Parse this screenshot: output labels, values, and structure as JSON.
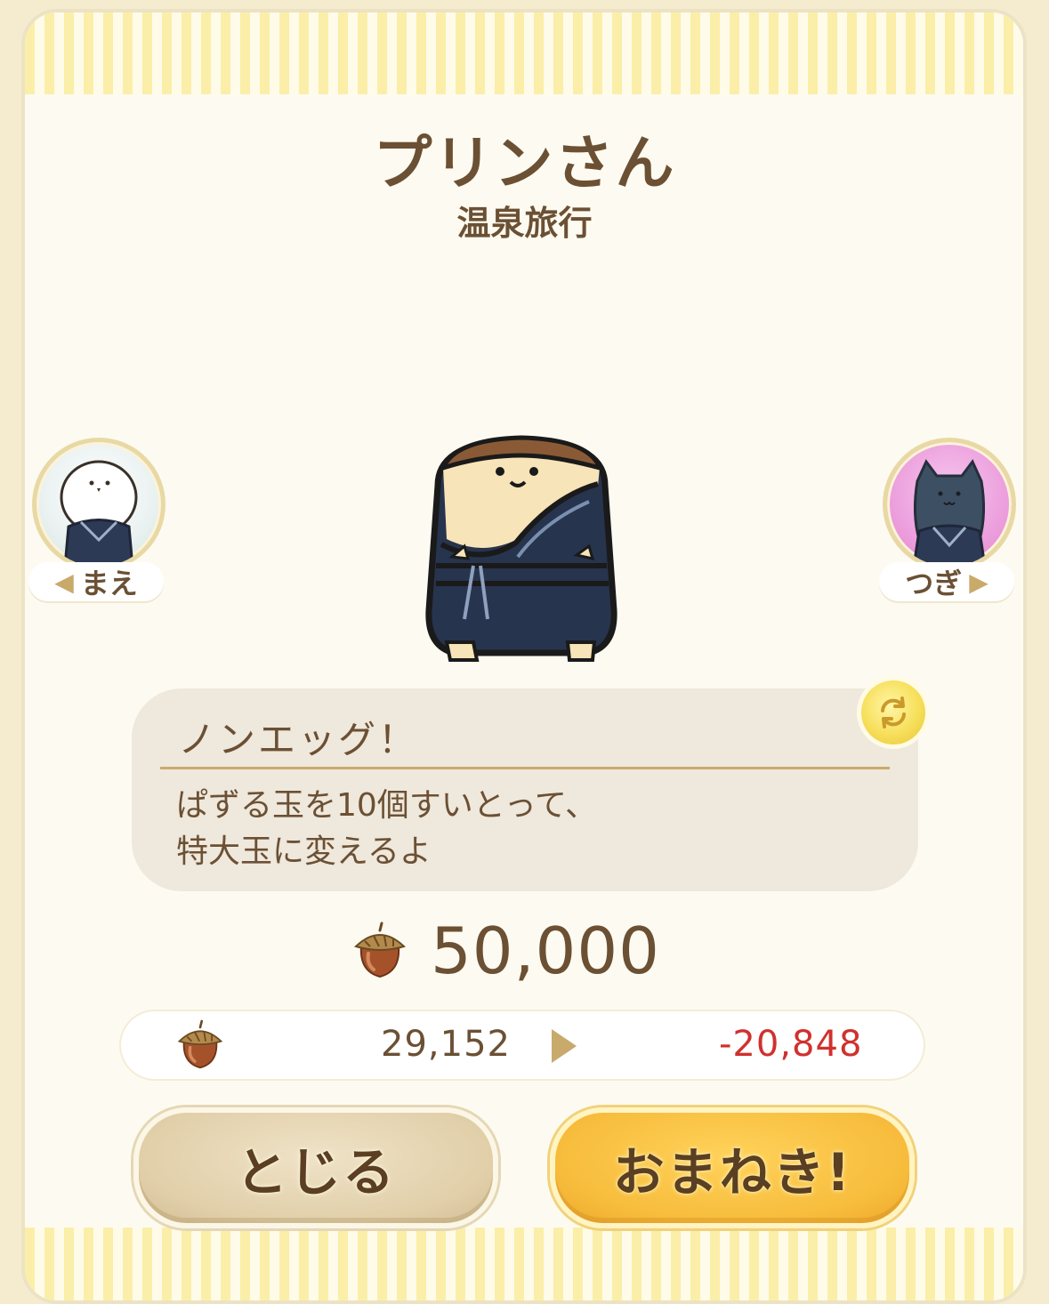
{
  "header": {
    "title": "プリンさん",
    "subtitle": "温泉旅行"
  },
  "nav": {
    "prev_label": "まえ",
    "next_label": "つぎ"
  },
  "skill": {
    "name": "ノンエッグ！",
    "description_line1": "ぱずる玉を10個すいとって、",
    "description_line2": "特大玉に変えるよ"
  },
  "cost": {
    "price": "50,000",
    "current_balance": "29,152",
    "after_balance": "-20,848",
    "after_color": "#d0312d",
    "currency_icon": "acorn-icon"
  },
  "buttons": {
    "close_label": "とじる",
    "invite_label": "おまねき!"
  },
  "colors": {
    "text_brown": "#6b5034",
    "invite_button": "#f7bc3c",
    "close_button": "#e1cfa9",
    "stripe": "#fbeea8"
  }
}
